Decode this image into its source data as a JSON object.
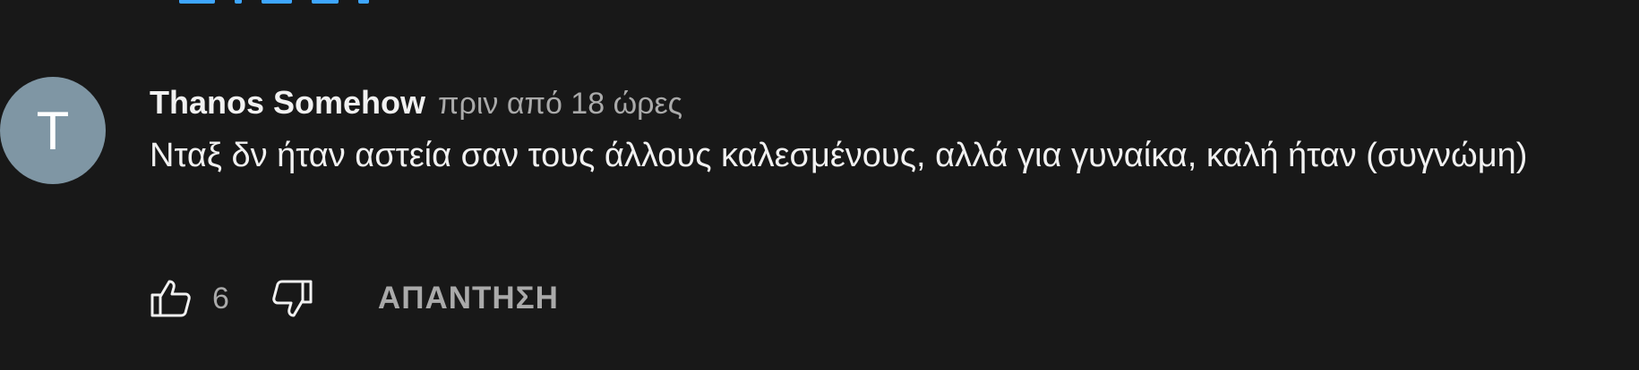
{
  "colors": {
    "background": "#181818",
    "avatar": "#7f96a4",
    "primary_text": "#f1f1f1",
    "secondary_text": "#aaaaaa",
    "link_blue": "#3ea6ff"
  },
  "comment": {
    "avatar_initial": "T",
    "author": "Thanos Somehow",
    "time": "πριν από 18 ώρες",
    "text": "Νταξ δν ήταν αστεία σαν τους άλλους καλεσμένους, αλλά για γυναίκα, καλή ήταν (συγνώμη)",
    "like_count": "6",
    "reply_label": "ΑΠΑΝΤΗΣΗ",
    "icons": {
      "like": "thumb-up-icon",
      "dislike": "thumb-down-icon"
    }
  }
}
